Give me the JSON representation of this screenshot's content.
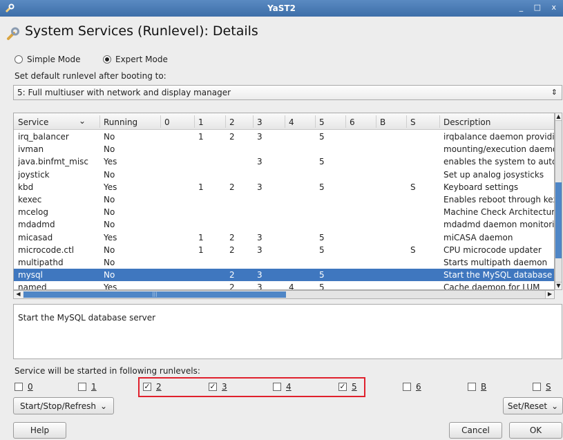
{
  "window": {
    "title": "YaST2",
    "controls": "_ □ x"
  },
  "page_title": "System Services (Runlevel): Details",
  "mode": {
    "simple": "Simple Mode",
    "expert": "Expert Mode",
    "selected": "expert"
  },
  "runlevel_label": "Set default runlevel after booting to:",
  "runlevel_value": "5: Full multiuser with network and display manager",
  "table": {
    "columns": [
      "Service",
      "Running",
      "0",
      "1",
      "2",
      "3",
      "4",
      "5",
      "6",
      "B",
      "S",
      "Description"
    ],
    "rows": [
      [
        "irq_balancer",
        "No",
        "",
        "1",
        "2",
        "3",
        "",
        "5",
        "",
        "",
        "",
        "irqbalance daemon providin"
      ],
      [
        "ivman",
        "No",
        "",
        "",
        "",
        "",
        "",
        "",
        "",
        "",
        "",
        "mounting/execution daemo"
      ],
      [
        "java.binfmt_misc",
        "Yes",
        "",
        "",
        "",
        "3",
        "",
        "5",
        "",
        "",
        "",
        "enables the system to auto"
      ],
      [
        "joystick",
        "No",
        "",
        "",
        "",
        "",
        "",
        "",
        "",
        "",
        "",
        "Set up analog josysticks"
      ],
      [
        "kbd",
        "Yes",
        "",
        "1",
        "2",
        "3",
        "",
        "5",
        "",
        "",
        "S",
        "Keyboard settings"
      ],
      [
        "kexec",
        "No",
        "",
        "",
        "",
        "",
        "",
        "",
        "",
        "",
        "",
        "Enables reboot through kex"
      ],
      [
        "mcelog",
        "No",
        "",
        "",
        "",
        "",
        "",
        "",
        "",
        "",
        "",
        "Machine Check Architectur"
      ],
      [
        "mdadmd",
        "No",
        "",
        "",
        "",
        "",
        "",
        "",
        "",
        "",
        "",
        "mdadmd daemon monitorin"
      ],
      [
        "micasad",
        "Yes",
        "",
        "1",
        "2",
        "3",
        "",
        "5",
        "",
        "",
        "",
        "miCASA daemon"
      ],
      [
        "microcode.ctl",
        "No",
        "",
        "1",
        "2",
        "3",
        "",
        "5",
        "",
        "",
        "S",
        "CPU microcode updater"
      ],
      [
        "multipathd",
        "No",
        "",
        "",
        "",
        "",
        "",
        "",
        "",
        "",
        "",
        "Starts multipath daemon"
      ],
      [
        "mysql",
        "No",
        "",
        "",
        "2",
        "3",
        "",
        "5",
        "",
        "",
        "",
        "Start the MySQL database"
      ],
      [
        "named",
        "Yes",
        "",
        "",
        "2",
        "3",
        "4",
        "5",
        "",
        "",
        "",
        "Cache daemon for LUM"
      ]
    ],
    "selected_row": 11
  },
  "description_text": "Start the MySQL database server",
  "started_label": "Service will be started in following runlevels:",
  "runlevels": [
    {
      "label": "0",
      "checked": false
    },
    {
      "label": "1",
      "checked": false
    },
    {
      "label": "2",
      "checked": true
    },
    {
      "label": "3",
      "checked": true
    },
    {
      "label": "4",
      "checked": false
    },
    {
      "label": "5",
      "checked": true
    },
    {
      "label": "6",
      "checked": false
    },
    {
      "label": "B",
      "checked": false
    },
    {
      "label": "S",
      "checked": false
    }
  ],
  "buttons": {
    "start_stop": "Start/Stop/Refresh",
    "set_reset": "Set/Reset",
    "help": "Help",
    "cancel": "Cancel",
    "ok": "OK"
  },
  "colors": {
    "titlebar": "#3d6ea8",
    "selection": "#3f77bf",
    "highlight_box": "#e0202c"
  }
}
